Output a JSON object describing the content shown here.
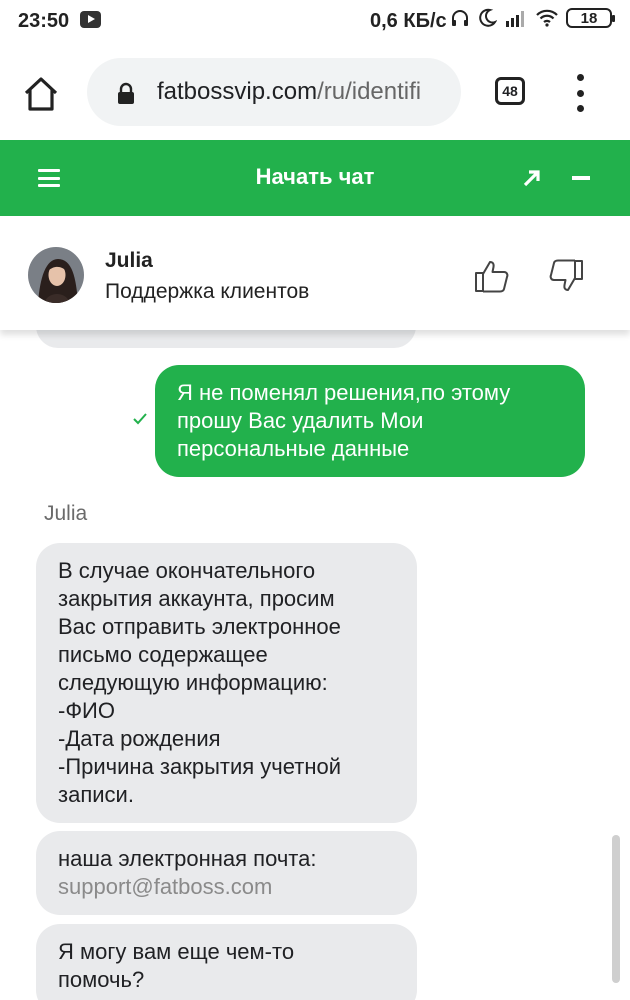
{
  "status_bar": {
    "time": "23:50",
    "speed": "0,6 КБ/с",
    "battery": "18"
  },
  "browser": {
    "url": "fatbossvip.com/ru/identifi",
    "url_domain": "fatbossvip.com",
    "url_path": "/ru/identifi",
    "tab_count": "48"
  },
  "chat_header": {
    "title": "Начать чат"
  },
  "agent": {
    "name": "Julia",
    "role": "Поддержка клиентов"
  },
  "colors": {
    "accent": "#22b14c",
    "agent_bubble": "#e9eaec"
  },
  "messages": {
    "user_message": [
      "Я не поменял решения,по этому",
      "прошу Вас удалить Мои",
      "персональные данные"
    ],
    "sender_label": "Julia",
    "agent_message_1": [
      "В случае окончательного",
      "закрытия аккаунта, просим",
      "Вас отправить электронное",
      "письмо содержащее",
      "следующую информацию:",
      "-ФИО",
      "-Дата рождения",
      "-Причина закрытия учетной",
      "записи."
    ],
    "agent_message_2": {
      "text": "наша электронная почта:",
      "email": "support@fatboss.com"
    },
    "agent_message_3": [
      "Я могу вам еще чем-то",
      "помочь?"
    ]
  }
}
